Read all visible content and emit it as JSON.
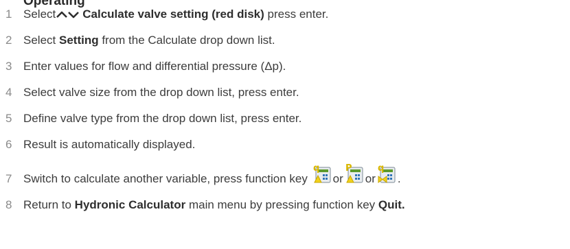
{
  "heading_fragment": "Operating",
  "steps": [
    {
      "num": "1",
      "pre": "Select",
      "bold": "Calculate valve setting (red disk)",
      "post": "press enter."
    },
    {
      "num": "2",
      "pre": "Select",
      "bold": "Setting",
      "post": "from the Calculate drop down list."
    },
    {
      "num": "3",
      "text": "Enter values for flow and differential pressure (Δp)."
    },
    {
      "num": "4",
      "text": "Select valve size from the drop down list, press enter."
    },
    {
      "num": "5",
      "text": "Define valve type from the drop down list, press enter."
    },
    {
      "num": "6",
      "text": "Result is automatically displayed."
    },
    {
      "num": "7",
      "text": "Switch to calculate another variable, press function key",
      "or1": "or",
      "or2": "or",
      "end": "."
    },
    {
      "num": "8",
      "pre": "Return to",
      "bold": "Hydronic Calculator",
      "mid": "main menu by pressing function key",
      "bold2": "Quit",
      "end": "."
    }
  ],
  "icons": {
    "arrows": "up-down-arrow-icon",
    "key1": "flow-dp-calc-icon",
    "key2": "pressure-temp-calc-icon",
    "key3": "flow-valve-calc-icon",
    "key1_letter": "q",
    "key2_letter": "P",
    "key3_letter": "q"
  },
  "colors": {
    "text": "#3c3c3c",
    "number": "#8a8a8a",
    "icon_yellow": "#f2d21b",
    "icon_green": "#5c9a2c",
    "icon_blue": "#2f74b8"
  }
}
